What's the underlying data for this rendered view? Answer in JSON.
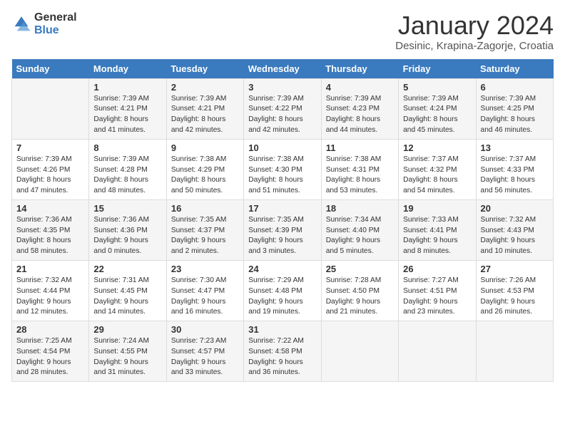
{
  "header": {
    "logo_general": "General",
    "logo_blue": "Blue",
    "title": "January 2024",
    "subtitle": "Desinic, Krapina-Zagorje, Croatia"
  },
  "weekdays": [
    "Sunday",
    "Monday",
    "Tuesday",
    "Wednesday",
    "Thursday",
    "Friday",
    "Saturday"
  ],
  "weeks": [
    [
      {
        "day": "",
        "sunrise": "",
        "sunset": "",
        "daylight": ""
      },
      {
        "day": "1",
        "sunrise": "Sunrise: 7:39 AM",
        "sunset": "Sunset: 4:21 PM",
        "daylight": "Daylight: 8 hours and 41 minutes."
      },
      {
        "day": "2",
        "sunrise": "Sunrise: 7:39 AM",
        "sunset": "Sunset: 4:21 PM",
        "daylight": "Daylight: 8 hours and 42 minutes."
      },
      {
        "day": "3",
        "sunrise": "Sunrise: 7:39 AM",
        "sunset": "Sunset: 4:22 PM",
        "daylight": "Daylight: 8 hours and 42 minutes."
      },
      {
        "day": "4",
        "sunrise": "Sunrise: 7:39 AM",
        "sunset": "Sunset: 4:23 PM",
        "daylight": "Daylight: 8 hours and 44 minutes."
      },
      {
        "day": "5",
        "sunrise": "Sunrise: 7:39 AM",
        "sunset": "Sunset: 4:24 PM",
        "daylight": "Daylight: 8 hours and 45 minutes."
      },
      {
        "day": "6",
        "sunrise": "Sunrise: 7:39 AM",
        "sunset": "Sunset: 4:25 PM",
        "daylight": "Daylight: 8 hours and 46 minutes."
      }
    ],
    [
      {
        "day": "7",
        "sunrise": "Sunrise: 7:39 AM",
        "sunset": "Sunset: 4:26 PM",
        "daylight": "Daylight: 8 hours and 47 minutes."
      },
      {
        "day": "8",
        "sunrise": "Sunrise: 7:39 AM",
        "sunset": "Sunset: 4:28 PM",
        "daylight": "Daylight: 8 hours and 48 minutes."
      },
      {
        "day": "9",
        "sunrise": "Sunrise: 7:38 AM",
        "sunset": "Sunset: 4:29 PM",
        "daylight": "Daylight: 8 hours and 50 minutes."
      },
      {
        "day": "10",
        "sunrise": "Sunrise: 7:38 AM",
        "sunset": "Sunset: 4:30 PM",
        "daylight": "Daylight: 8 hours and 51 minutes."
      },
      {
        "day": "11",
        "sunrise": "Sunrise: 7:38 AM",
        "sunset": "Sunset: 4:31 PM",
        "daylight": "Daylight: 8 hours and 53 minutes."
      },
      {
        "day": "12",
        "sunrise": "Sunrise: 7:37 AM",
        "sunset": "Sunset: 4:32 PM",
        "daylight": "Daylight: 8 hours and 54 minutes."
      },
      {
        "day": "13",
        "sunrise": "Sunrise: 7:37 AM",
        "sunset": "Sunset: 4:33 PM",
        "daylight": "Daylight: 8 hours and 56 minutes."
      }
    ],
    [
      {
        "day": "14",
        "sunrise": "Sunrise: 7:36 AM",
        "sunset": "Sunset: 4:35 PM",
        "daylight": "Daylight: 8 hours and 58 minutes."
      },
      {
        "day": "15",
        "sunrise": "Sunrise: 7:36 AM",
        "sunset": "Sunset: 4:36 PM",
        "daylight": "Daylight: 9 hours and 0 minutes."
      },
      {
        "day": "16",
        "sunrise": "Sunrise: 7:35 AM",
        "sunset": "Sunset: 4:37 PM",
        "daylight": "Daylight: 9 hours and 2 minutes."
      },
      {
        "day": "17",
        "sunrise": "Sunrise: 7:35 AM",
        "sunset": "Sunset: 4:39 PM",
        "daylight": "Daylight: 9 hours and 3 minutes."
      },
      {
        "day": "18",
        "sunrise": "Sunrise: 7:34 AM",
        "sunset": "Sunset: 4:40 PM",
        "daylight": "Daylight: 9 hours and 5 minutes."
      },
      {
        "day": "19",
        "sunrise": "Sunrise: 7:33 AM",
        "sunset": "Sunset: 4:41 PM",
        "daylight": "Daylight: 9 hours and 8 minutes."
      },
      {
        "day": "20",
        "sunrise": "Sunrise: 7:32 AM",
        "sunset": "Sunset: 4:43 PM",
        "daylight": "Daylight: 9 hours and 10 minutes."
      }
    ],
    [
      {
        "day": "21",
        "sunrise": "Sunrise: 7:32 AM",
        "sunset": "Sunset: 4:44 PM",
        "daylight": "Daylight: 9 hours and 12 minutes."
      },
      {
        "day": "22",
        "sunrise": "Sunrise: 7:31 AM",
        "sunset": "Sunset: 4:45 PM",
        "daylight": "Daylight: 9 hours and 14 minutes."
      },
      {
        "day": "23",
        "sunrise": "Sunrise: 7:30 AM",
        "sunset": "Sunset: 4:47 PM",
        "daylight": "Daylight: 9 hours and 16 minutes."
      },
      {
        "day": "24",
        "sunrise": "Sunrise: 7:29 AM",
        "sunset": "Sunset: 4:48 PM",
        "daylight": "Daylight: 9 hours and 19 minutes."
      },
      {
        "day": "25",
        "sunrise": "Sunrise: 7:28 AM",
        "sunset": "Sunset: 4:50 PM",
        "daylight": "Daylight: 9 hours and 21 minutes."
      },
      {
        "day": "26",
        "sunrise": "Sunrise: 7:27 AM",
        "sunset": "Sunset: 4:51 PM",
        "daylight": "Daylight: 9 hours and 23 minutes."
      },
      {
        "day": "27",
        "sunrise": "Sunrise: 7:26 AM",
        "sunset": "Sunset: 4:53 PM",
        "daylight": "Daylight: 9 hours and 26 minutes."
      }
    ],
    [
      {
        "day": "28",
        "sunrise": "Sunrise: 7:25 AM",
        "sunset": "Sunset: 4:54 PM",
        "daylight": "Daylight: 9 hours and 28 minutes."
      },
      {
        "day": "29",
        "sunrise": "Sunrise: 7:24 AM",
        "sunset": "Sunset: 4:55 PM",
        "daylight": "Daylight: 9 hours and 31 minutes."
      },
      {
        "day": "30",
        "sunrise": "Sunrise: 7:23 AM",
        "sunset": "Sunset: 4:57 PM",
        "daylight": "Daylight: 9 hours and 33 minutes."
      },
      {
        "day": "31",
        "sunrise": "Sunrise: 7:22 AM",
        "sunset": "Sunset: 4:58 PM",
        "daylight": "Daylight: 9 hours and 36 minutes."
      },
      {
        "day": "",
        "sunrise": "",
        "sunset": "",
        "daylight": ""
      },
      {
        "day": "",
        "sunrise": "",
        "sunset": "",
        "daylight": ""
      },
      {
        "day": "",
        "sunrise": "",
        "sunset": "",
        "daylight": ""
      }
    ]
  ]
}
